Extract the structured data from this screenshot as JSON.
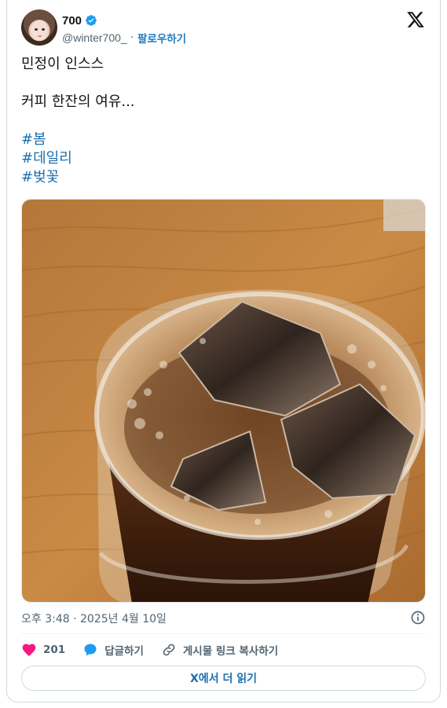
{
  "author": {
    "display_name": "700",
    "handle": "@winter700_",
    "separator": "·",
    "follow_label": "팔로우하기",
    "verified_color": "#1d9bf0"
  },
  "post": {
    "lines": [
      "민정이 인스스",
      "커피 한잔의 여유..."
    ],
    "hashtags": [
      "#봄",
      "#데일리",
      "#벚꽃"
    ]
  },
  "image": {
    "subject": "iced-coffee-glass-on-wooden-table"
  },
  "meta": {
    "timestamp": "오후 3:48 · 2025년 4월 10일"
  },
  "actions": {
    "like_count": "201",
    "reply_label": "답글하기",
    "copy_link_label": "게시물 링크 복사하기",
    "like_color": "#f91880",
    "reply_color": "#1d9bf0"
  },
  "read_more_label": "X에서 더 읽기"
}
